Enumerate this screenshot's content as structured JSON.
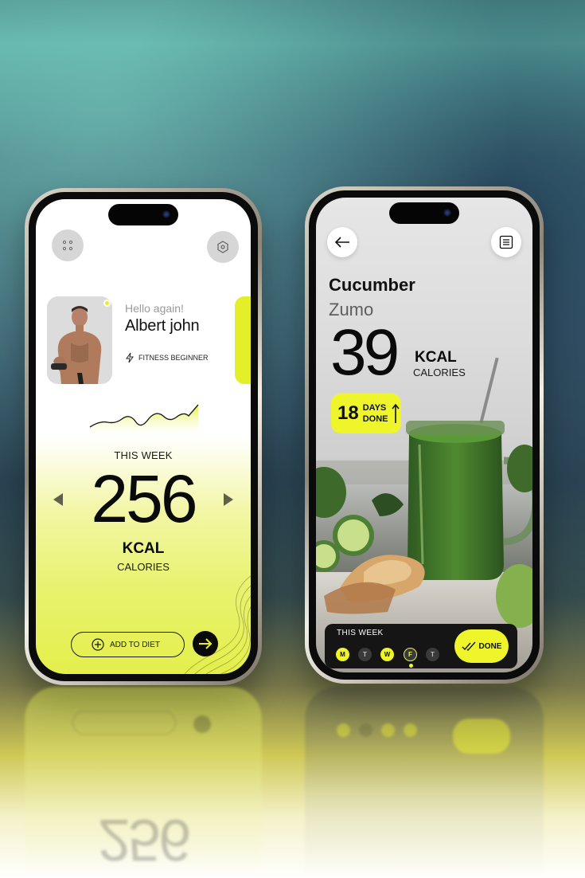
{
  "left_screen": {
    "greeting": "Hello again!",
    "user_name": "Albert john",
    "level": "FITNESS BEGINNER",
    "period_label": "THIS WEEK",
    "calories_value": "256",
    "unit": "KCAL",
    "unit_sub": "CALORIES",
    "add_button_label": "ADD TO DIET",
    "icons": {
      "menu": "grid-dots-icon",
      "settings": "hexagon-settings-icon",
      "level": "lightning-icon",
      "prev": "triangle-left-icon",
      "next": "triangle-right-icon",
      "add": "plus-circle-icon",
      "go": "arrow-right-icon"
    },
    "accent_color": "#e4ef2a"
  },
  "right_screen": {
    "title": "Cucumber",
    "subtitle": "Zumo",
    "calories_value": "39",
    "unit": "KCAL",
    "unit_sub": "CALORIES",
    "streak_days": "18",
    "streak_line1": "DAYS",
    "streak_line2": "DONE",
    "week_label": "THIS WEEK",
    "days": [
      {
        "label": "M",
        "state": "done"
      },
      {
        "label": "T",
        "state": "missed"
      },
      {
        "label": "W",
        "state": "done"
      },
      {
        "label": "F",
        "state": "current"
      },
      {
        "label": "T",
        "state": "missed"
      }
    ],
    "done_button_label": "DONE",
    "icons": {
      "back": "arrow-left-icon",
      "menu": "document-lines-icon",
      "streak": "arrow-up-icon",
      "done": "double-check-icon"
    },
    "accent_color": "#eef52b"
  }
}
